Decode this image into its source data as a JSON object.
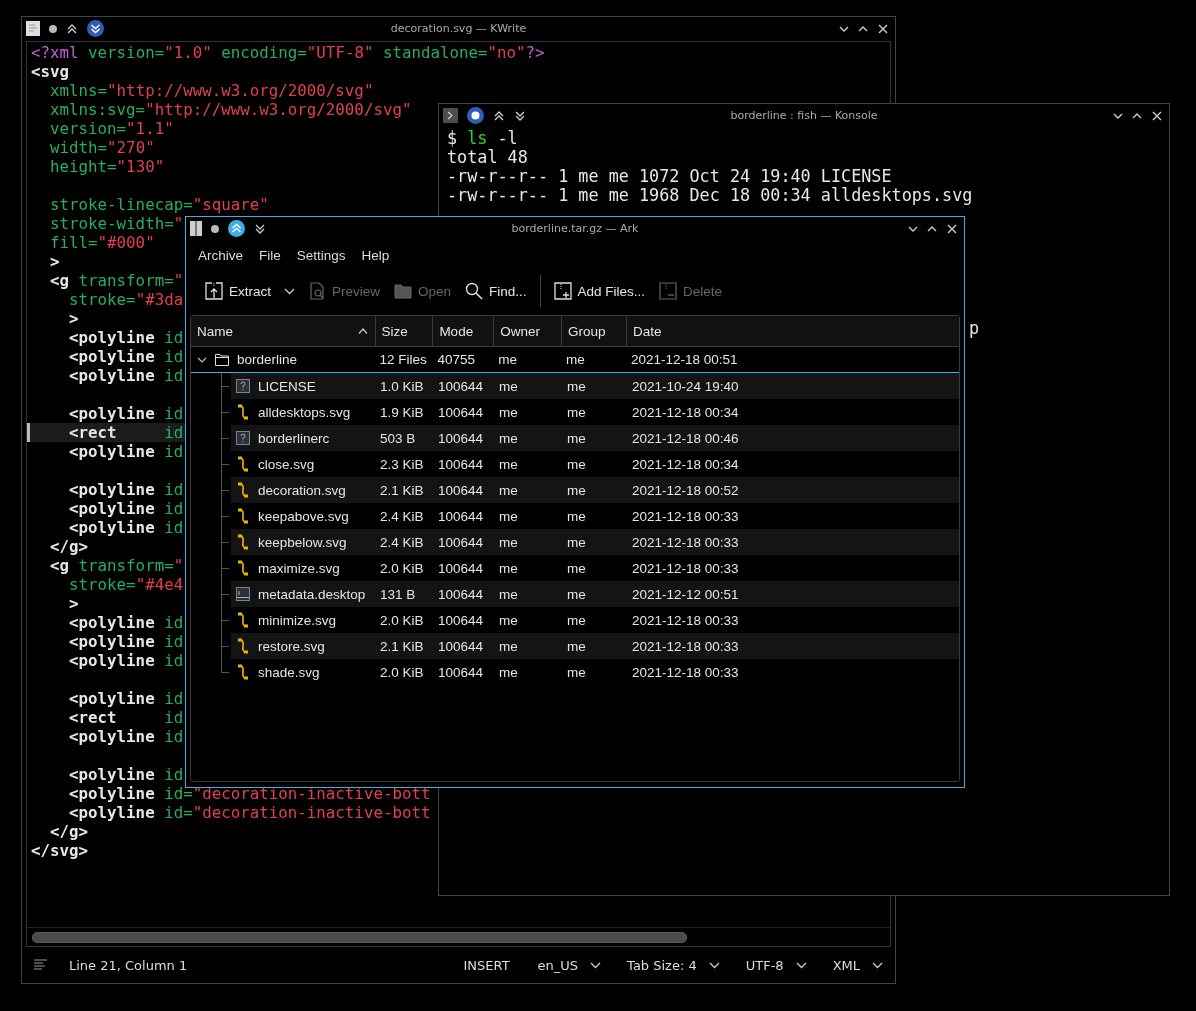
{
  "kwrite": {
    "title": "decoration.svg — KWrite",
    "lines": [
      {
        "current": false,
        "tokens": [
          {
            "kind": "pi",
            "t": "<?xml"
          },
          {
            "kind": "attr",
            "t": " version="
          },
          {
            "kind": "val",
            "t": "\"1.0\""
          },
          {
            "kind": "attr",
            "t": " encoding="
          },
          {
            "kind": "val",
            "t": "\"UTF-8\""
          },
          {
            "kind": "attr",
            "t": " standalone="
          },
          {
            "kind": "val",
            "t": "\"no\""
          },
          {
            "kind": "pi",
            "t": "?>"
          }
        ]
      },
      {
        "current": false,
        "tokens": [
          {
            "kind": "tag",
            "t": "<svg"
          }
        ]
      },
      {
        "current": false,
        "tokens": [
          {
            "kind": "attr",
            "t": "  xmlns="
          },
          {
            "kind": "val",
            "t": "\"http://www.w3.org/2000/svg\""
          }
        ]
      },
      {
        "current": false,
        "tokens": [
          {
            "kind": "attr",
            "t": "  xmlns:svg="
          },
          {
            "kind": "val",
            "t": "\"http://www.w3.org/2000/svg\""
          }
        ]
      },
      {
        "current": false,
        "tokens": [
          {
            "kind": "attr",
            "t": "  version="
          },
          {
            "kind": "val",
            "t": "\"1.1\""
          }
        ]
      },
      {
        "current": false,
        "tokens": [
          {
            "kind": "attr",
            "t": "  width="
          },
          {
            "kind": "val",
            "t": "\"270\""
          }
        ]
      },
      {
        "current": false,
        "tokens": [
          {
            "kind": "attr",
            "t": "  height="
          },
          {
            "kind": "val",
            "t": "\"130\""
          }
        ]
      },
      {
        "current": false
      },
      {
        "current": false,
        "tokens": [
          {
            "kind": "attr",
            "t": "  stroke-linecap="
          },
          {
            "kind": "val",
            "t": "\"square\""
          }
        ]
      },
      {
        "current": false,
        "tokens": [
          {
            "kind": "attr",
            "t": "  stroke-width="
          },
          {
            "kind": "val",
            "t": "\""
          }
        ]
      },
      {
        "current": false,
        "tokens": [
          {
            "kind": "attr",
            "t": "  fill="
          },
          {
            "kind": "val",
            "t": "\"#000\""
          }
        ]
      },
      {
        "current": false,
        "tokens": [
          {
            "kind": "tag",
            "t": "  >"
          }
        ]
      },
      {
        "current": false,
        "tokens": [
          {
            "kind": "tag",
            "t": "  <g"
          },
          {
            "kind": "attr",
            "t": " transform="
          },
          {
            "kind": "val",
            "t": "\""
          }
        ]
      },
      {
        "current": false,
        "tokens": [
          {
            "kind": "attr",
            "t": "    stroke="
          },
          {
            "kind": "val",
            "t": "\"#3da"
          }
        ]
      },
      {
        "current": false,
        "tokens": [
          {
            "kind": "tag",
            "t": "    >"
          }
        ]
      },
      {
        "current": false,
        "tokens": [
          {
            "kind": "tag",
            "t": "    <polyline"
          },
          {
            "kind": "attr",
            "t": " id"
          }
        ]
      },
      {
        "current": false,
        "tokens": [
          {
            "kind": "tag",
            "t": "    <polyline"
          },
          {
            "kind": "attr",
            "t": " id"
          }
        ]
      },
      {
        "current": false,
        "tokens": [
          {
            "kind": "tag",
            "t": "    <polyline"
          },
          {
            "kind": "attr",
            "t": " id"
          }
        ]
      },
      {
        "current": false
      },
      {
        "current": false,
        "tokens": [
          {
            "kind": "tag",
            "t": "    <polyline"
          },
          {
            "kind": "attr",
            "t": " id"
          }
        ]
      },
      {
        "current": true,
        "tokens": [
          {
            "kind": "tag",
            "t": "    <rect"
          },
          {
            "kind": "attr",
            "t": "     id"
          }
        ]
      },
      {
        "current": false,
        "tokens": [
          {
            "kind": "tag",
            "t": "    <polyline"
          },
          {
            "kind": "attr",
            "t": " id"
          }
        ]
      },
      {
        "current": false
      },
      {
        "current": false,
        "tokens": [
          {
            "kind": "tag",
            "t": "    <polyline"
          },
          {
            "kind": "attr",
            "t": " id"
          }
        ]
      },
      {
        "current": false,
        "tokens": [
          {
            "kind": "tag",
            "t": "    <polyline"
          },
          {
            "kind": "attr",
            "t": " id"
          }
        ]
      },
      {
        "current": false,
        "tokens": [
          {
            "kind": "tag",
            "t": "    <polyline"
          },
          {
            "kind": "attr",
            "t": " id"
          }
        ]
      },
      {
        "current": false,
        "tokens": [
          {
            "kind": "tag",
            "t": "  </g>"
          }
        ]
      },
      {
        "current": false,
        "tokens": [
          {
            "kind": "tag",
            "t": "  <g"
          },
          {
            "kind": "attr",
            "t": " transform="
          },
          {
            "kind": "val",
            "t": "\""
          }
        ]
      },
      {
        "current": false,
        "tokens": [
          {
            "kind": "attr",
            "t": "    stroke="
          },
          {
            "kind": "val",
            "t": "\"#4e4"
          }
        ]
      },
      {
        "current": false,
        "tokens": [
          {
            "kind": "tag",
            "t": "    >"
          }
        ]
      },
      {
        "current": false,
        "tokens": [
          {
            "kind": "tag",
            "t": "    <polyline"
          },
          {
            "kind": "attr",
            "t": " id"
          }
        ]
      },
      {
        "current": false,
        "tokens": [
          {
            "kind": "tag",
            "t": "    <polyline"
          },
          {
            "kind": "attr",
            "t": " id"
          }
        ]
      },
      {
        "current": false,
        "tokens": [
          {
            "kind": "tag",
            "t": "    <polyline"
          },
          {
            "kind": "attr",
            "t": " id"
          }
        ]
      },
      {
        "current": false
      },
      {
        "current": false,
        "tokens": [
          {
            "kind": "tag",
            "t": "    <polyline"
          },
          {
            "kind": "attr",
            "t": " id"
          }
        ]
      },
      {
        "current": false,
        "tokens": [
          {
            "kind": "tag",
            "t": "    <rect"
          },
          {
            "kind": "attr",
            "t": "     id"
          }
        ]
      },
      {
        "current": false,
        "tokens": [
          {
            "kind": "tag",
            "t": "    <polyline"
          },
          {
            "kind": "attr",
            "t": " id"
          }
        ]
      },
      {
        "current": false
      },
      {
        "current": false,
        "tokens": [
          {
            "kind": "tag",
            "t": "    <polyline"
          },
          {
            "kind": "attr",
            "t": " id"
          }
        ]
      },
      {
        "current": false,
        "tokens": [
          {
            "kind": "tag",
            "t": "    <polyline"
          },
          {
            "kind": "attr",
            "t": " id="
          },
          {
            "kind": "val",
            "t": "\"decoration-inactive-bott"
          }
        ]
      },
      {
        "current": false,
        "tokens": [
          {
            "kind": "tag",
            "t": "    <polyline"
          },
          {
            "kind": "attr",
            "t": " id="
          },
          {
            "kind": "val",
            "t": "\"decoration-inactive-bott"
          }
        ]
      },
      {
        "current": false,
        "tokens": [
          {
            "kind": "tag",
            "t": "  </g>"
          }
        ]
      },
      {
        "current": false,
        "tokens": [
          {
            "kind": "tag",
            "t": "</svg>"
          }
        ]
      }
    ],
    "status": {
      "position": "Line 21, Column 1",
      "items": [
        {
          "kind": "label",
          "text": "INSERT"
        },
        {
          "kind": "dropdown",
          "text": "en_US"
        },
        {
          "kind": "dropdown",
          "text": "Tab Size: 4"
        },
        {
          "kind": "dropdown",
          "text": "UTF-8"
        },
        {
          "kind": "dropdown",
          "text": "XML"
        }
      ]
    }
  },
  "konsole": {
    "title": "borderline : fish — Konsole",
    "command": {
      "prompt": "$",
      "program": "ls",
      "args": "-l"
    },
    "lines": [
      "total 48",
      "-rw-r--r-- 1 me me 1072 Oct 24 19:40 LICENSE",
      "-rw-r--r-- 1 me me 1968 Dec 18 00:34 alldesktops.svg"
    ],
    "visible_tail": "p"
  },
  "ark": {
    "title": "borderline.tar.gz — Ark",
    "menu": [
      "Archive",
      "File",
      "Settings",
      "Help"
    ],
    "toolbar": [
      {
        "kind": "extract",
        "label": "Extract",
        "disabled": false
      },
      {
        "kind": "preview",
        "label": "Preview",
        "disabled": true
      },
      {
        "kind": "open",
        "label": "Open",
        "disabled": true
      },
      {
        "kind": "find",
        "label": "Find...",
        "disabled": false
      },
      {
        "kind": "add",
        "label": "Add Files...",
        "disabled": false
      },
      {
        "kind": "delete",
        "label": "Delete",
        "disabled": true
      }
    ],
    "columns": [
      "Name",
      "Size",
      "Mode",
      "Owner",
      "Group",
      "Date"
    ],
    "root": {
      "name": "borderline",
      "expanded": true,
      "size": "12 Files",
      "mode": "40755",
      "owner": "me",
      "group": "me",
      "date": "2021-12-18 00:51",
      "children": [
        {
          "kind": "unknown",
          "name": "LICENSE",
          "size": "1.0 KiB",
          "mode": "100644",
          "owner": "me",
          "group": "me",
          "date": "2021-10-24 19:40"
        },
        {
          "kind": "svg",
          "name": "alldesktops.svg",
          "size": "1.9 KiB",
          "mode": "100644",
          "owner": "me",
          "group": "me",
          "date": "2021-12-18 00:34"
        },
        {
          "kind": "unknown",
          "name": "borderlinerc",
          "size": "503 B",
          "mode": "100644",
          "owner": "me",
          "group": "me",
          "date": "2021-12-18 00:46"
        },
        {
          "kind": "svg",
          "name": "close.svg",
          "size": "2.3 KiB",
          "mode": "100644",
          "owner": "me",
          "group": "me",
          "date": "2021-12-18 00:34"
        },
        {
          "kind": "svg",
          "name": "decoration.svg",
          "size": "2.1 KiB",
          "mode": "100644",
          "owner": "me",
          "group": "me",
          "date": "2021-12-18 00:52"
        },
        {
          "kind": "svg",
          "name": "keepabove.svg",
          "size": "2.4 KiB",
          "mode": "100644",
          "owner": "me",
          "group": "me",
          "date": "2021-12-18 00:33"
        },
        {
          "kind": "svg",
          "name": "keepbelow.svg",
          "size": "2.4 KiB",
          "mode": "100644",
          "owner": "me",
          "group": "me",
          "date": "2021-12-18 00:33"
        },
        {
          "kind": "svg",
          "name": "maximize.svg",
          "size": "2.0 KiB",
          "mode": "100644",
          "owner": "me",
          "group": "me",
          "date": "2021-12-18 00:33"
        },
        {
          "kind": "desktop",
          "name": "metadata.desktop",
          "size": "131 B",
          "mode": "100644",
          "owner": "me",
          "group": "me",
          "date": "2021-12-12 00:51"
        },
        {
          "kind": "svg",
          "name": "minimize.svg",
          "size": "2.0 KiB",
          "mode": "100644",
          "owner": "me",
          "group": "me",
          "date": "2021-12-18 00:33"
        },
        {
          "kind": "svg",
          "name": "restore.svg",
          "size": "2.1 KiB",
          "mode": "100644",
          "owner": "me",
          "group": "me",
          "date": "2021-12-18 00:33"
        },
        {
          "kind": "svg",
          "name": "shade.svg",
          "size": "2.0 KiB",
          "mode": "100644",
          "owner": "me",
          "group": "me",
          "date": "2021-12-18 00:33"
        }
      ]
    }
  }
}
